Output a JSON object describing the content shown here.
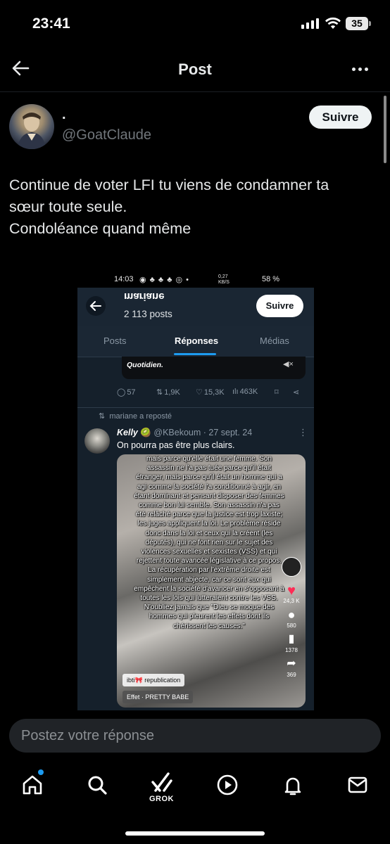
{
  "status_bar": {
    "time": "23:41",
    "battery": "35"
  },
  "header": {
    "title": "Post"
  },
  "author": {
    "display_name": ".",
    "handle": "@GoatClaude",
    "follow_label": "Suivre"
  },
  "post": {
    "lines": [
      "Continue de voter LFI tu viens de condamner ta",
      "sœur toute seule.",
      "Condoléance quand même"
    ]
  },
  "embedded": {
    "status_time": "14:03",
    "status_right": "0,27 KB/S",
    "status_battery": "58 %",
    "profile_name": "mariane",
    "posts_count": "2 113 posts",
    "follow_label": "Suivre",
    "tabs": [
      {
        "label": "Posts"
      },
      {
        "label": "Réponses"
      },
      {
        "label": "Médias"
      }
    ],
    "video_brand": "Quotidien.",
    "actions": {
      "comments": "57",
      "reposts": "1,9K",
      "likes": "15,3K",
      "views": "463K"
    },
    "repost_label": "mariane a reposté",
    "tweet": {
      "user": "Kelly",
      "handle": "@KBekoum · 27 sept. 24",
      "text": "On pourra pas être plus clairs."
    },
    "caption": "mais parce qu'elle était une femme. Son assassin ne l'a pas tuée parce qu'il était étranger, mais parce qu'il était un homme qui a agi comme la société l'a conditionné à agir, en étant dominant et pensant disposer des femmes comme bon lui semble. Son assassin n'a pas été relâché parce que la justice est trop laxiste; les juges appliquent la loi. Le problème réside donc dans la loi et ceux qui la créent (les députés), qui ne font rien sur le sujet des violences sexuelles et sexistes (VSS) et qui rejettent toute avancée législative à ce propos. La récupération par l'extrême droite est simplement abjecte, car ce sont eux qui empêchent la société d'avancer en s'opposant à toutes les lois qui lutteraient contre les VSS. N'oubliez jamais que \"Dieu se moque des hommes qui pleurent les effets dont ils chérissent les causes.\"",
    "side_counts": {
      "likes": "24,3 K",
      "comments": "580",
      "saves": "1378",
      "shares": "369"
    },
    "badge_republication": "ibti🎀 republication",
    "badge_effect": "Effet · PRETTY BABE"
  },
  "reply": {
    "placeholder": "Postez votre réponse"
  },
  "bottom_nav": {
    "grok_label": "GROK"
  }
}
